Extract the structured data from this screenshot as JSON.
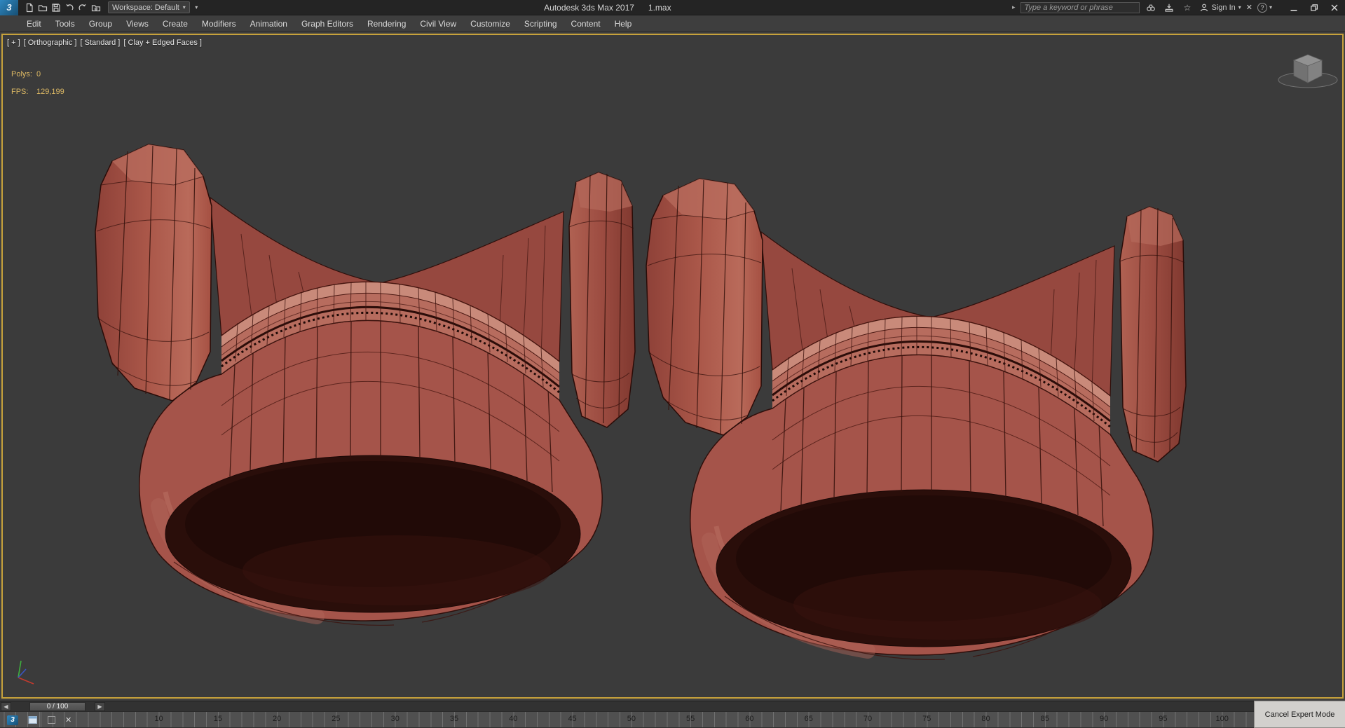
{
  "window": {
    "logo_text": "3",
    "title": "Autodesk 3ds Max 2017",
    "file_name": "1.max",
    "workspace_label": "Workspace: Default",
    "search_placeholder": "Type a keyword or phrase",
    "sign_in_label": "Sign In",
    "quick_access_icons": [
      "new-scene-icon",
      "open-file-icon",
      "save-file-icon",
      "undo-icon",
      "redo-icon",
      "project-folder-icon"
    ],
    "infocenter_icons": [
      "infocenter-toggle-icon",
      "binoculars-search-icon",
      "communication-center-icon",
      "favorites-star-icon",
      "user-icon",
      "exchange-x-icon",
      "help-icon"
    ],
    "window_controls": [
      "minimize-icon",
      "restore-icon",
      "close-icon"
    ]
  },
  "menu_bar": {
    "items": [
      "Edit",
      "Tools",
      "Group",
      "Views",
      "Create",
      "Modifiers",
      "Animation",
      "Graph Editors",
      "Rendering",
      "Civil View",
      "Customize",
      "Scripting",
      "Content",
      "Help"
    ]
  },
  "viewport": {
    "label_segments": [
      "[ + ]",
      "[ Orthographic ]",
      "[ Standard ]",
      "[ Clay + Edged Faces ]"
    ],
    "stats": {
      "polys_label": "Polys:",
      "polys_value": "0",
      "fps_label": "FPS:",
      "fps_value": "129,199"
    },
    "background_color": "#3b3b3b",
    "active_border_color": "#c7a23b",
    "shading_mode": "Clay + Edged Faces",
    "model_base_color": "#a5544a",
    "model_edge_color": "#2f0f0b"
  },
  "timeline": {
    "time_display": "0 / 100",
    "current_frame": 0,
    "total_frames": 100,
    "ruler_labels": [
      10,
      15,
      20,
      25,
      30,
      35,
      40,
      45,
      50,
      55,
      60,
      65,
      70,
      75,
      80,
      85,
      90,
      95,
      100
    ]
  },
  "expert_mode": {
    "cancel_button_label": "Cancel Expert Mode"
  },
  "mini_toolbar": {
    "icons": [
      "max-taskbar-icon",
      "window-icon",
      "empty-box-icon",
      "close-icon"
    ]
  }
}
